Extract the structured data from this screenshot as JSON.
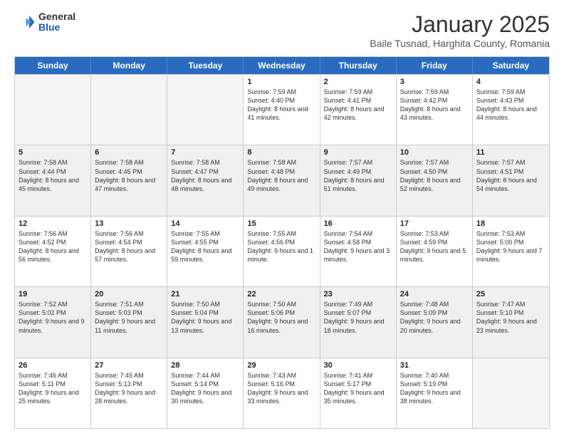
{
  "logo": {
    "general": "General",
    "blue": "Blue"
  },
  "title": "January 2025",
  "subtitle": "Baile Tusnad, Harghita County, Romania",
  "header_days": [
    "Sunday",
    "Monday",
    "Tuesday",
    "Wednesday",
    "Thursday",
    "Friday",
    "Saturday"
  ],
  "weeks": [
    [
      {
        "day": "",
        "text": "",
        "empty": true
      },
      {
        "day": "",
        "text": "",
        "empty": true
      },
      {
        "day": "",
        "text": "",
        "empty": true
      },
      {
        "day": "1",
        "text": "Sunrise: 7:59 AM\nSunset: 4:40 PM\nDaylight: 8 hours and 41 minutes."
      },
      {
        "day": "2",
        "text": "Sunrise: 7:59 AM\nSunset: 4:41 PM\nDaylight: 8 hours and 42 minutes."
      },
      {
        "day": "3",
        "text": "Sunrise: 7:59 AM\nSunset: 4:42 PM\nDaylight: 8 hours and 43 minutes."
      },
      {
        "day": "4",
        "text": "Sunrise: 7:59 AM\nSunset: 4:43 PM\nDaylight: 8 hours and 44 minutes."
      }
    ],
    [
      {
        "day": "5",
        "text": "Sunrise: 7:58 AM\nSunset: 4:44 PM\nDaylight: 8 hours and 45 minutes."
      },
      {
        "day": "6",
        "text": "Sunrise: 7:58 AM\nSunset: 4:45 PM\nDaylight: 8 hours and 47 minutes."
      },
      {
        "day": "7",
        "text": "Sunrise: 7:58 AM\nSunset: 4:47 PM\nDaylight: 8 hours and 48 minutes."
      },
      {
        "day": "8",
        "text": "Sunrise: 7:58 AM\nSunset: 4:48 PM\nDaylight: 8 hours and 49 minutes."
      },
      {
        "day": "9",
        "text": "Sunrise: 7:57 AM\nSunset: 4:49 PM\nDaylight: 8 hours and 51 minutes."
      },
      {
        "day": "10",
        "text": "Sunrise: 7:57 AM\nSunset: 4:50 PM\nDaylight: 8 hours and 52 minutes."
      },
      {
        "day": "11",
        "text": "Sunrise: 7:57 AM\nSunset: 4:51 PM\nDaylight: 8 hours and 54 minutes."
      }
    ],
    [
      {
        "day": "12",
        "text": "Sunrise: 7:56 AM\nSunset: 4:52 PM\nDaylight: 8 hours and 56 minutes."
      },
      {
        "day": "13",
        "text": "Sunrise: 7:56 AM\nSunset: 4:54 PM\nDaylight: 8 hours and 57 minutes."
      },
      {
        "day": "14",
        "text": "Sunrise: 7:55 AM\nSunset: 4:55 PM\nDaylight: 8 hours and 59 minutes."
      },
      {
        "day": "15",
        "text": "Sunrise: 7:55 AM\nSunset: 4:56 PM\nDaylight: 9 hours and 1 minute."
      },
      {
        "day": "16",
        "text": "Sunrise: 7:54 AM\nSunset: 4:58 PM\nDaylight: 9 hours and 3 minutes."
      },
      {
        "day": "17",
        "text": "Sunrise: 7:53 AM\nSunset: 4:59 PM\nDaylight: 9 hours and 5 minutes."
      },
      {
        "day": "18",
        "text": "Sunrise: 7:53 AM\nSunset: 5:00 PM\nDaylight: 9 hours and 7 minutes."
      }
    ],
    [
      {
        "day": "19",
        "text": "Sunrise: 7:52 AM\nSunset: 5:02 PM\nDaylight: 9 hours and 9 minutes."
      },
      {
        "day": "20",
        "text": "Sunrise: 7:51 AM\nSunset: 5:03 PM\nDaylight: 9 hours and 11 minutes."
      },
      {
        "day": "21",
        "text": "Sunrise: 7:50 AM\nSunset: 5:04 PM\nDaylight: 9 hours and 13 minutes."
      },
      {
        "day": "22",
        "text": "Sunrise: 7:50 AM\nSunset: 5:06 PM\nDaylight: 9 hours and 16 minutes."
      },
      {
        "day": "23",
        "text": "Sunrise: 7:49 AM\nSunset: 5:07 PM\nDaylight: 9 hours and 18 minutes."
      },
      {
        "day": "24",
        "text": "Sunrise: 7:48 AM\nSunset: 5:09 PM\nDaylight: 9 hours and 20 minutes."
      },
      {
        "day": "25",
        "text": "Sunrise: 7:47 AM\nSunset: 5:10 PM\nDaylight: 9 hours and 23 minutes."
      }
    ],
    [
      {
        "day": "26",
        "text": "Sunrise: 7:46 AM\nSunset: 5:11 PM\nDaylight: 9 hours and 25 minutes."
      },
      {
        "day": "27",
        "text": "Sunrise: 7:45 AM\nSunset: 5:13 PM\nDaylight: 9 hours and 28 minutes."
      },
      {
        "day": "28",
        "text": "Sunrise: 7:44 AM\nSunset: 5:14 PM\nDaylight: 9 hours and 30 minutes."
      },
      {
        "day": "29",
        "text": "Sunrise: 7:43 AM\nSunset: 5:16 PM\nDaylight: 9 hours and 33 minutes."
      },
      {
        "day": "30",
        "text": "Sunrise: 7:41 AM\nSunset: 5:17 PM\nDaylight: 9 hours and 35 minutes."
      },
      {
        "day": "31",
        "text": "Sunrise: 7:40 AM\nSunset: 5:19 PM\nDaylight: 9 hours and 38 minutes."
      },
      {
        "day": "",
        "text": "",
        "empty": true
      }
    ]
  ]
}
